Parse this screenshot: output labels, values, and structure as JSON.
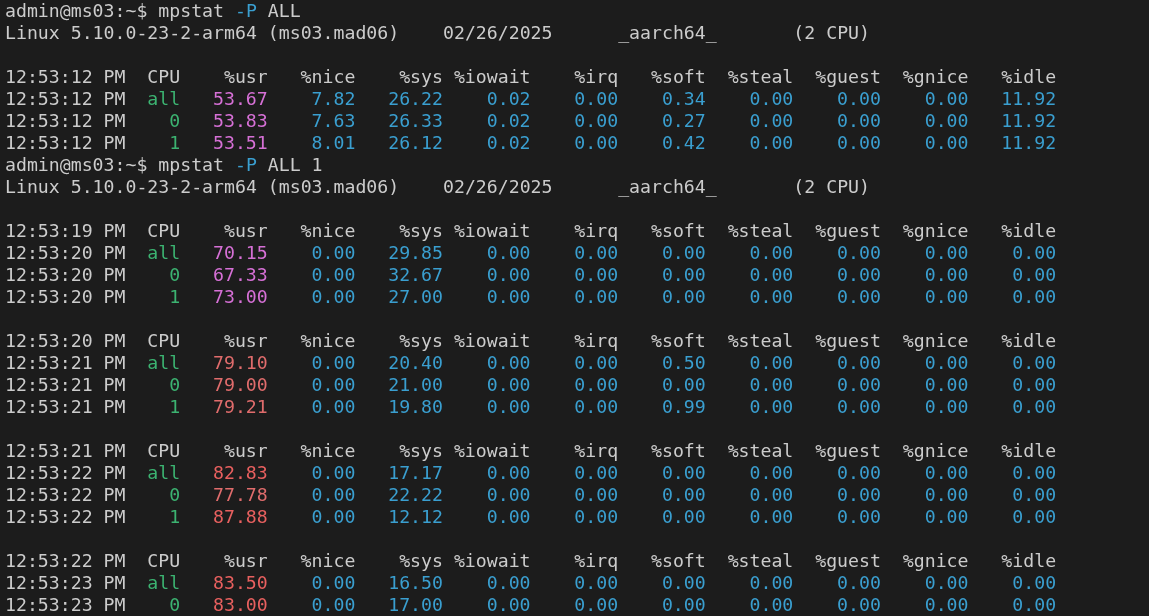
{
  "sessions": [
    {
      "prompt": {
        "user_host": "admin@ms03:~$",
        "command": "mpstat",
        "option": "-P",
        "args": "ALL"
      },
      "info": [
        "Linux 5.10.0-23-2-arm64 (ms03.mad06)",
        "02/26/2025",
        "_aarch64_",
        "(2 CPU)"
      ],
      "blocks": [
        {
          "header": {
            "time": "12:53:12 PM",
            "columns": [
              "CPU",
              "%usr",
              "%nice",
              "%sys",
              "%iowait",
              "%irq",
              "%soft",
              "%steal",
              "%guest",
              "%gnice",
              "%idle"
            ]
          },
          "rows": [
            {
              "time": "12:53:12 PM",
              "cpu": "all",
              "usr": "53.67",
              "color": "#d670d6",
              "values": [
                "7.82",
                "26.22",
                "0.02",
                "0.00",
                "0.34",
                "0.00",
                "0.00",
                "0.00",
                "11.92"
              ]
            },
            {
              "time": "12:53:12 PM",
              "cpu": "0",
              "usr": "53.83",
              "color": "#d670d6",
              "values": [
                "7.63",
                "26.33",
                "0.02",
                "0.00",
                "0.27",
                "0.00",
                "0.00",
                "0.00",
                "11.92"
              ]
            },
            {
              "time": "12:53:12 PM",
              "cpu": "1",
              "usr": "53.51",
              "color": "#d670d6",
              "values": [
                "8.01",
                "26.12",
                "0.02",
                "0.00",
                "0.42",
                "0.00",
                "0.00",
                "0.00",
                "11.92"
              ]
            }
          ]
        }
      ]
    },
    {
      "prompt": {
        "user_host": "admin@ms03:~$",
        "command": "mpstat",
        "option": "-P",
        "args": "ALL 1"
      },
      "info": [
        "Linux 5.10.0-23-2-arm64 (ms03.mad06)",
        "02/26/2025",
        "_aarch64_",
        "(2 CPU)"
      ],
      "blocks": [
        {
          "header": {
            "time": "12:53:19 PM",
            "columns": [
              "CPU",
              "%usr",
              "%nice",
              "%sys",
              "%iowait",
              "%irq",
              "%soft",
              "%steal",
              "%guest",
              "%gnice",
              "%idle"
            ]
          },
          "rows": [
            {
              "time": "12:53:20 PM",
              "cpu": "all",
              "usr": "70.15",
              "color": "#d670d6",
              "values": [
                "0.00",
                "29.85",
                "0.00",
                "0.00",
                "0.00",
                "0.00",
                "0.00",
                "0.00",
                "0.00"
              ]
            },
            {
              "time": "12:53:20 PM",
              "cpu": "0",
              "usr": "67.33",
              "color": "#d670d6",
              "values": [
                "0.00",
                "32.67",
                "0.00",
                "0.00",
                "0.00",
                "0.00",
                "0.00",
                "0.00",
                "0.00"
              ]
            },
            {
              "time": "12:53:20 PM",
              "cpu": "1",
              "usr": "73.00",
              "color": "#d670d6",
              "values": [
                "0.00",
                "27.00",
                "0.00",
                "0.00",
                "0.00",
                "0.00",
                "0.00",
                "0.00",
                "0.00"
              ]
            }
          ]
        },
        {
          "header": {
            "time": "12:53:20 PM",
            "columns": [
              "CPU",
              "%usr",
              "%nice",
              "%sys",
              "%iowait",
              "%irq",
              "%soft",
              "%steal",
              "%guest",
              "%gnice",
              "%idle"
            ]
          },
          "rows": [
            {
              "time": "12:53:21 PM",
              "cpu": "all",
              "usr": "79.10",
              "color": "#e06c6c",
              "values": [
                "0.00",
                "20.40",
                "0.00",
                "0.00",
                "0.50",
                "0.00",
                "0.00",
                "0.00",
                "0.00"
              ]
            },
            {
              "time": "12:53:21 PM",
              "cpu": "0",
              "usr": "79.00",
              "color": "#e06c6c",
              "values": [
                "0.00",
                "21.00",
                "0.00",
                "0.00",
                "0.00",
                "0.00",
                "0.00",
                "0.00",
                "0.00"
              ]
            },
            {
              "time": "12:53:21 PM",
              "cpu": "1",
              "usr": "79.21",
              "color": "#e06c6c",
              "values": [
                "0.00",
                "19.80",
                "0.00",
                "0.00",
                "0.99",
                "0.00",
                "0.00",
                "0.00",
                "0.00"
              ]
            }
          ]
        },
        {
          "header": {
            "time": "12:53:21 PM",
            "columns": [
              "CPU",
              "%usr",
              "%nice",
              "%sys",
              "%iowait",
              "%irq",
              "%soft",
              "%steal",
              "%guest",
              "%gnice",
              "%idle"
            ]
          },
          "rows": [
            {
              "time": "12:53:22 PM",
              "cpu": "all",
              "usr": "82.83",
              "color": "#e8605f",
              "values": [
                "0.00",
                "17.17",
                "0.00",
                "0.00",
                "0.00",
                "0.00",
                "0.00",
                "0.00",
                "0.00"
              ]
            },
            {
              "time": "12:53:22 PM",
              "cpu": "0",
              "usr": "77.78",
              "color": "#e06c6c",
              "values": [
                "0.00",
                "22.22",
                "0.00",
                "0.00",
                "0.00",
                "0.00",
                "0.00",
                "0.00",
                "0.00"
              ]
            },
            {
              "time": "12:53:22 PM",
              "cpu": "1",
              "usr": "87.88",
              "color": "#e8605f",
              "values": [
                "0.00",
                "12.12",
                "0.00",
                "0.00",
                "0.00",
                "0.00",
                "0.00",
                "0.00",
                "0.00"
              ]
            }
          ]
        },
        {
          "header": {
            "time": "12:53:22 PM",
            "columns": [
              "CPU",
              "%usr",
              "%nice",
              "%sys",
              "%iowait",
              "%irq",
              "%soft",
              "%steal",
              "%guest",
              "%gnice",
              "%idle"
            ]
          },
          "rows": [
            {
              "time": "12:53:23 PM",
              "cpu": "all",
              "usr": "83.50",
              "color": "#e8605f",
              "values": [
                "0.00",
                "16.50",
                "0.00",
                "0.00",
                "0.00",
                "0.00",
                "0.00",
                "0.00",
                "0.00"
              ]
            },
            {
              "time": "12:53:23 PM",
              "cpu": "0",
              "usr": "83.00",
              "color": "#e8605f",
              "values": [
                "0.00",
                "17.00",
                "0.00",
                "0.00",
                "0.00",
                "0.00",
                "0.00",
                "0.00",
                "0.00"
              ]
            }
          ]
        }
      ]
    }
  ]
}
